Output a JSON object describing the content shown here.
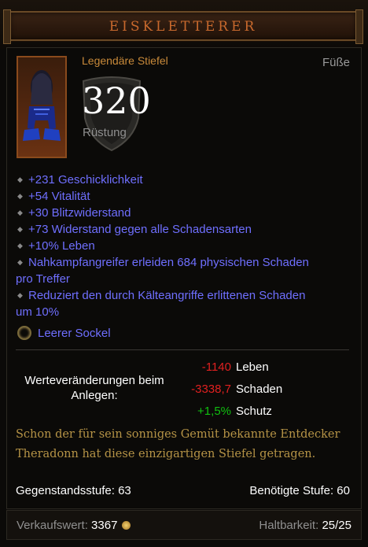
{
  "item": {
    "name": "EISKLETTERER",
    "subtype": "Legendäre Stiefel",
    "slot": "Füße",
    "armor_value": "320",
    "armor_label": "Rüstung"
  },
  "stats": [
    "+231 Geschicklichkeit",
    "+54 Vitalität",
    "+30 Blitzwiderstand",
    "+73 Widerstand gegen alle Schadensarten",
    "+10% Leben"
  ],
  "stats_wrapped": [
    {
      "line1": "Nahkampfangreifer erleiden 684 physischen Schaden",
      "line2": "pro Treffer"
    },
    {
      "line1": "Reduziert den durch Kälteangriffe erlittenen Schaden",
      "line2": "um 10%"
    }
  ],
  "socket": {
    "label": "Leerer Sockel"
  },
  "compare": {
    "label": "Werteveränderungen beim Anlegen:",
    "rows": [
      {
        "value": "-1140",
        "name": "Leben",
        "color": "#e02020"
      },
      {
        "value": "-3338,7",
        "name": "Schaden",
        "color": "#e02020"
      },
      {
        "value": "+1,5%",
        "name": "Schutz",
        "color": "#10c010"
      }
    ]
  },
  "flavor_text": "Schon der für sein sonniges Gemüt bekannte Entdecker Theradonn hat diese einzigartigen Stiefel getragen.",
  "item_level": "Gegenstandsstufe: 63",
  "required_level": "Benötigte Stufe: 60",
  "footer": {
    "sell_label": "Verkaufswert:",
    "sell_value": "3367",
    "durability_label": "Haltbarkeit:",
    "durability_value": "25/25"
  },
  "colors": {
    "title": "#c8692d",
    "magic_affix": "#6f6fff",
    "flavor": "#b59346"
  }
}
